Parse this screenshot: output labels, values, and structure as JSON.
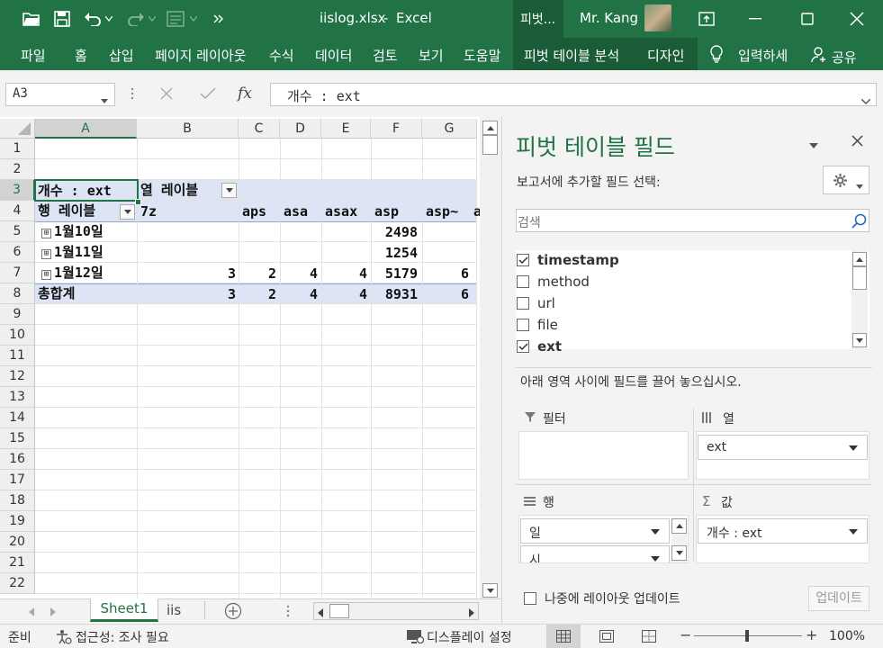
{
  "window": {
    "filename": "iislog.xlsx",
    "separator": "-",
    "app": "Excel",
    "context_tab": "피벗...",
    "user": "Mr. Kang"
  },
  "ribbon": {
    "tabs": [
      "파일",
      "홈",
      "삽입",
      "페이지 레이아웃",
      "수식",
      "데이터",
      "검토",
      "보기",
      "도움말",
      "피벗 테이블 분석",
      "디자인"
    ],
    "tell_me": "입력하세",
    "share": "공유"
  },
  "formula_bar": {
    "name_box": "A3",
    "formula": "개수 : ext"
  },
  "grid": {
    "columns": [
      "A",
      "B",
      "C",
      "D",
      "E",
      "F",
      "G"
    ],
    "rows": [
      "1",
      "2",
      "3",
      "4",
      "5",
      "6",
      "7",
      "8",
      "9",
      "10",
      "11",
      "12",
      "13",
      "14",
      "15",
      "16",
      "17",
      "18",
      "19",
      "20",
      "21",
      "22"
    ],
    "pivot": {
      "value_label": "개수 : ext",
      "col_label": "열 레이블",
      "row_label": "행 레이블",
      "headers": [
        "7z",
        "aps",
        "asa",
        "asax",
        "asp",
        "asp~",
        "a"
      ],
      "data_rows": [
        {
          "label": "1월10일",
          "values": [
            "",
            "",
            "",
            "",
            "2498",
            ""
          ]
        },
        {
          "label": "1월11일",
          "values": [
            "",
            "",
            "",
            "",
            "1254",
            ""
          ]
        },
        {
          "label": "1월12일",
          "values": [
            "3",
            "2",
            "4",
            "4",
            "5179",
            "6"
          ]
        }
      ],
      "total": {
        "label": "총합계",
        "values": [
          "3",
          "2",
          "4",
          "4",
          "8931",
          "6"
        ]
      },
      "expand_symbol": "⊞"
    }
  },
  "sheets": {
    "tabs": [
      "Sheet1",
      "iis"
    ],
    "active": "Sheet1"
  },
  "pivot_pane": {
    "title": "피벗 테이블 필드",
    "choose_label": "보고서에 추가할 필드 선택:",
    "search_placeholder": "검색",
    "fields": [
      {
        "name": "timestamp",
        "checked": true
      },
      {
        "name": "method",
        "checked": false
      },
      {
        "name": "url",
        "checked": false
      },
      {
        "name": "file",
        "checked": false
      },
      {
        "name": "ext",
        "checked": true
      }
    ],
    "drag_hint": "아래 영역 사이에 필드를 끌어 놓으십시오.",
    "areas": {
      "filter": {
        "label": "필터",
        "items": []
      },
      "columns": {
        "label": "열",
        "items": [
          "ext"
        ]
      },
      "rows": {
        "label": "행",
        "items": [
          "일",
          "시"
        ]
      },
      "values": {
        "label": "값",
        "items": [
          "개수 : ext"
        ]
      }
    },
    "defer_label": "나중에 레이아웃 업데이트",
    "update_button": "업데이트"
  },
  "status_bar": {
    "ready": "준비",
    "accessibility": "접근성: 조사 필요",
    "display_settings": "디스플레이 설정",
    "zoom": "100%",
    "zoom_level": 1.0
  },
  "colors": {
    "excel_green": "#217346",
    "context_green": "#1a5c38",
    "pivot_band": "#dce4f5"
  }
}
